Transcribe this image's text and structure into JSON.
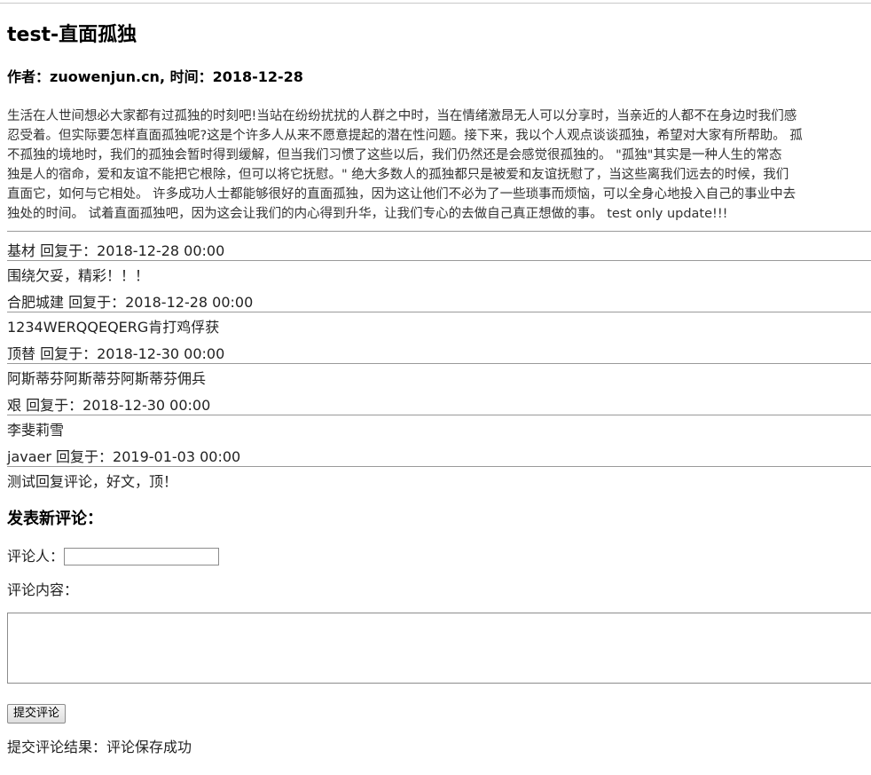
{
  "article": {
    "title": "test-直面孤独",
    "meta": "作者：zuowenjun.cn, 时间：2018-12-28",
    "body_lines": [
      "生活在人世间想必大家都有过孤独的时刻吧!当站在纷纷扰扰的人群之中时，当在情绪激昂无人可以分享时，当亲近的人都不在身边时我们感",
      "忍受着。但实际要怎样直面孤独呢?这是个许多人从来不愿意提起的潜在性问题。接下来，我以个人观点谈谈孤独，希望对大家有所帮助。 孤",
      "不孤独的境地时，我们的孤独会暂时得到缓解，但当我们习惯了这些以后，我们仍然还是会感觉很孤独的。 \"孤独\"其实是一种人生的常态",
      "独是人的宿命，爱和友谊不能把它根除，但可以将它抚慰。\" 绝大多数人的孤独都只是被爱和友谊抚慰了，当这些离我们远去的时候，我们",
      "直面它，如何与它相处。 许多成功人士都能够很好的直面孤独，因为这让他们不必为了一些琐事而烦恼，可以全身心地投入自己的事业中去",
      "独处的时间。 试着直面孤独吧，因为这会让我们的内心得到升华，让我们专心的去做自己真正想做的事。 test only update!!!"
    ]
  },
  "comments": [
    {
      "header": "基材 回复于：2018-12-28 00:00",
      "content": "围绕欠妥，精彩！！！"
    },
    {
      "header": "合肥城建 回复于：2018-12-28 00:00",
      "content": "1234WERQQEQERG肯打鸡俘获"
    },
    {
      "header": "顶替 回复于：2018-12-30 00:00",
      "content": "阿斯蒂芬阿斯蒂芬阿斯蒂芬佣兵"
    },
    {
      "header": "艰 回复于：2018-12-30 00:00",
      "content": "李斐莉雪"
    },
    {
      "header": "javaer 回复于：2019-01-03 00:00",
      "content": "测试回复评论，好文，顶！"
    }
  ],
  "form": {
    "title": "发表新评论：",
    "name_label": "评论人：",
    "name_value": "",
    "content_label": "评论内容：",
    "content_value": "",
    "submit_label": "提交评论",
    "result": "提交评论结果：评论保存成功"
  }
}
